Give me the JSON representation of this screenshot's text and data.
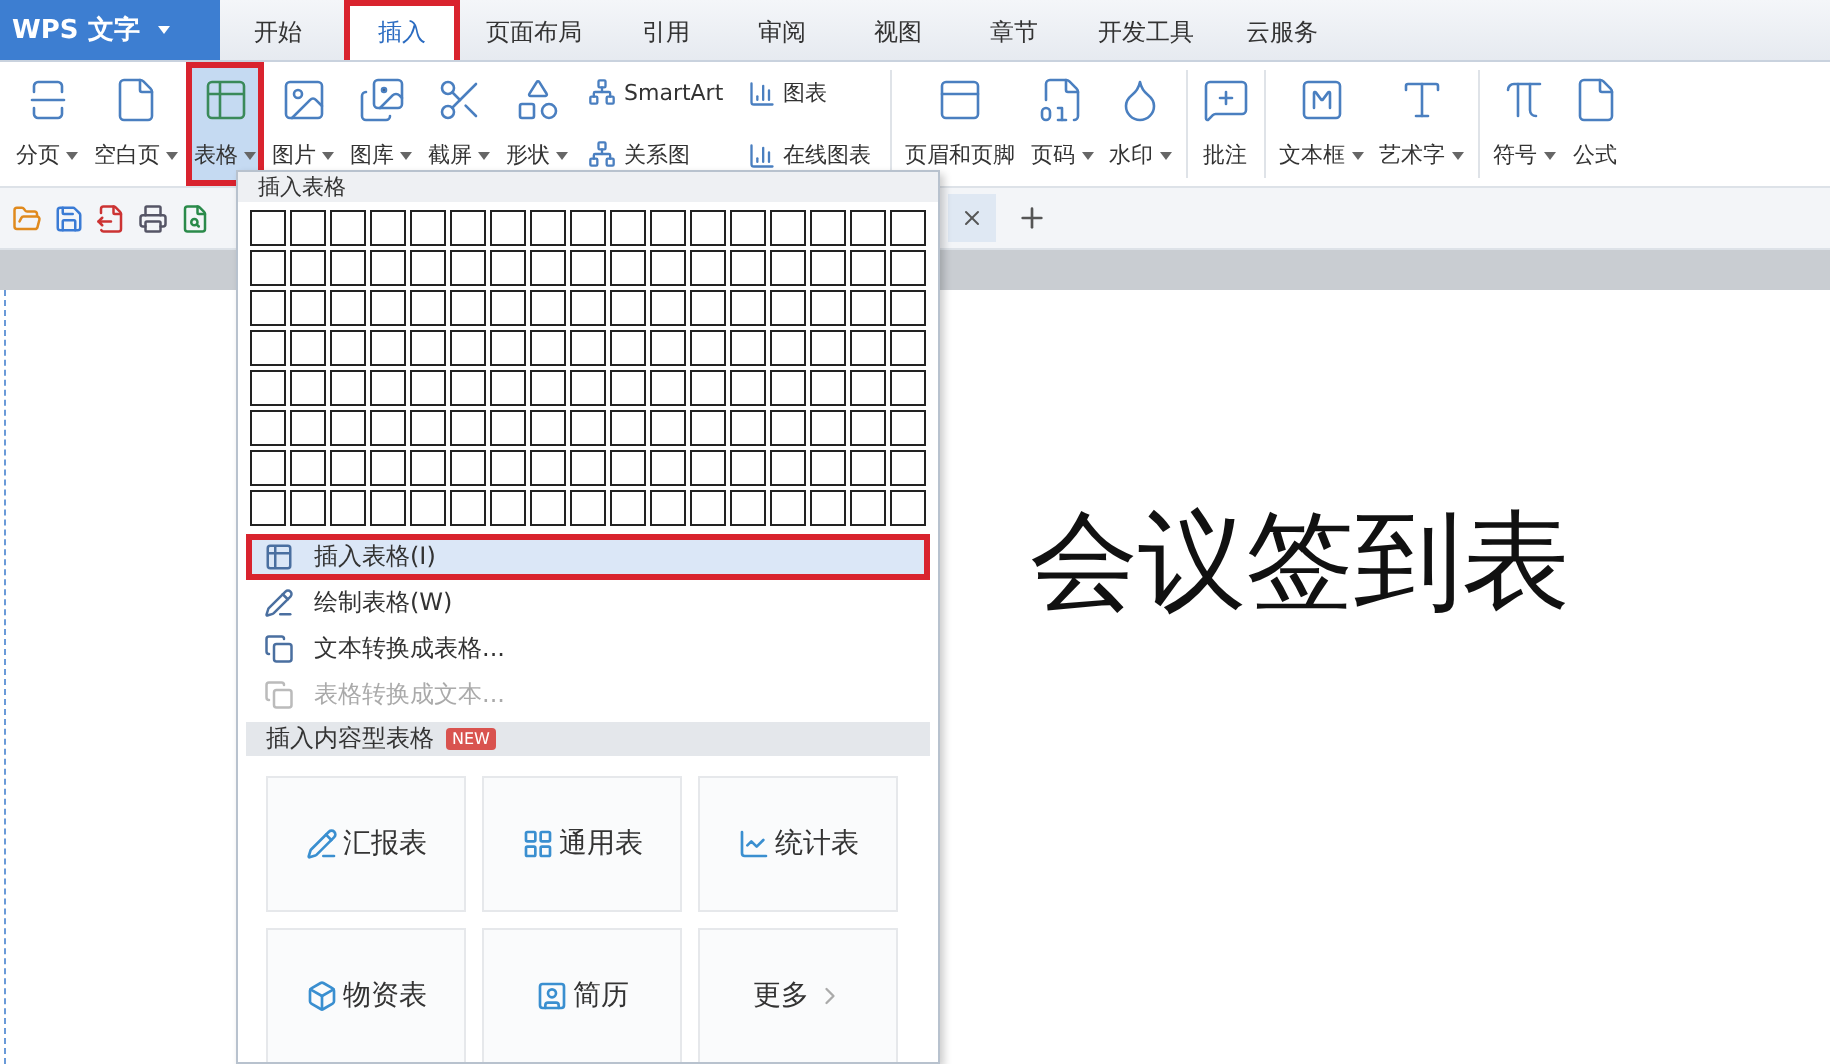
{
  "app_menu": {
    "label": "WPS 文字"
  },
  "tabs": [
    {
      "label": "开始",
      "selected": false,
      "highlighted": false
    },
    {
      "label": "插入",
      "selected": true,
      "highlighted": true
    },
    {
      "label": "页面布局",
      "selected": false,
      "highlighted": false
    },
    {
      "label": "引用",
      "selected": false,
      "highlighted": false
    },
    {
      "label": "审阅",
      "selected": false,
      "highlighted": false
    },
    {
      "label": "视图",
      "selected": false,
      "highlighted": false
    },
    {
      "label": "章节",
      "selected": false,
      "highlighted": false
    },
    {
      "label": "开发工具",
      "selected": false,
      "highlighted": false
    },
    {
      "label": "云服务",
      "selected": false,
      "highlighted": false
    }
  ],
  "ribbon": [
    {
      "kind": "large",
      "label": "分页",
      "dropdown": true,
      "selected": false,
      "highlighted": false
    },
    {
      "kind": "large",
      "label": "空白页",
      "dropdown": true,
      "selected": false,
      "highlighted": false
    },
    {
      "kind": "large",
      "label": "表格",
      "dropdown": true,
      "selected": true,
      "highlighted": true
    },
    {
      "kind": "large",
      "label": "图片",
      "dropdown": true,
      "selected": false,
      "highlighted": false
    },
    {
      "kind": "large",
      "label": "图库",
      "dropdown": true,
      "selected": false,
      "highlighted": false
    },
    {
      "kind": "large",
      "label": "截屏",
      "dropdown": true,
      "selected": false,
      "highlighted": false
    },
    {
      "kind": "large",
      "label": "形状",
      "dropdown": true,
      "selected": false,
      "highlighted": false
    },
    {
      "kind": "stack",
      "items": [
        "SmartArt",
        "关系图"
      ]
    },
    {
      "kind": "stack",
      "items": [
        "图表",
        "在线图表"
      ]
    },
    {
      "kind": "separator"
    },
    {
      "kind": "large",
      "label": "页眉和页脚",
      "dropdown": false,
      "selected": false,
      "highlighted": false
    },
    {
      "kind": "large",
      "label": "页码",
      "dropdown": true,
      "selected": false,
      "highlighted": false
    },
    {
      "kind": "large",
      "label": "水印",
      "dropdown": true,
      "selected": false,
      "highlighted": false
    },
    {
      "kind": "separator"
    },
    {
      "kind": "large",
      "label": "批注",
      "dropdown": false,
      "selected": false,
      "highlighted": false
    },
    {
      "kind": "separator"
    },
    {
      "kind": "large",
      "label": "文本框",
      "dropdown": true,
      "selected": false,
      "highlighted": false
    },
    {
      "kind": "large",
      "label": "艺术字",
      "dropdown": true,
      "selected": false,
      "highlighted": false
    },
    {
      "kind": "separator"
    },
    {
      "kind": "large",
      "label": "符号",
      "dropdown": true,
      "selected": false,
      "highlighted": false
    },
    {
      "kind": "large",
      "label": "公式",
      "dropdown": false,
      "selected": false,
      "highlighted": false
    }
  ],
  "table_menu": {
    "title": "插入表格",
    "items": [
      {
        "label": "插入表格(I)",
        "highlighted": true,
        "disabled": false
      },
      {
        "label": "绘制表格(W)",
        "highlighted": false,
        "disabled": false
      },
      {
        "label": "文本转换成表格...",
        "highlighted": false,
        "disabled": false
      },
      {
        "label": "表格转换成文本...",
        "highlighted": false,
        "disabled": true
      }
    ],
    "section": {
      "title": "插入内容型表格",
      "badge": "NEW"
    },
    "templates": [
      {
        "label": "汇报表"
      },
      {
        "label": "通用表"
      },
      {
        "label": "统计表"
      },
      {
        "label": "物资表"
      },
      {
        "label": "简历"
      },
      {
        "label": "更多",
        "kind": "more"
      }
    ]
  },
  "document": {
    "title": "会议签到表"
  }
}
